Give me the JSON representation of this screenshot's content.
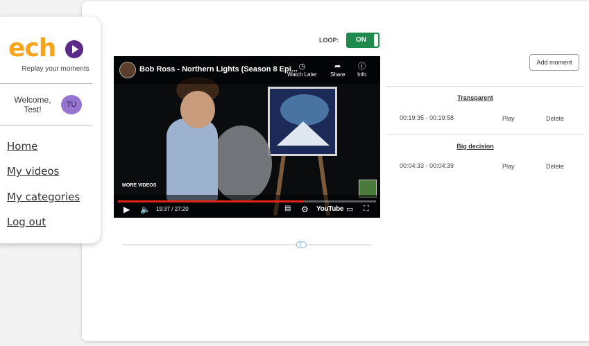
{
  "sidebar": {
    "logo_text": "ech",
    "tagline": "Replay your moments",
    "welcome": "Welcome, Test!",
    "avatar_initials": "TU",
    "nav": [
      {
        "label": "Home"
      },
      {
        "label": "My videos"
      },
      {
        "label": "My categories"
      },
      {
        "label": "Log out"
      }
    ]
  },
  "controls": {
    "loop_label": "LOOP:",
    "loop_state": "ON",
    "add_moment_label": "Add moment"
  },
  "player": {
    "title": "Bob Ross - Northern Lights (Season 8 Epi...",
    "top_buttons": [
      {
        "label": "Watch Later",
        "icon": "clock-icon"
      },
      {
        "label": "Share",
        "icon": "share-icon"
      },
      {
        "label": "Info",
        "icon": "info-icon"
      }
    ],
    "more_videos": "MORE VIDEOS",
    "time": "19:37 / 27:20",
    "progress": 0.718,
    "youtube_label": "YouTube"
  },
  "moments": [
    {
      "title": "Transparent",
      "range": "00:19:35 - 00:19:58",
      "play": "Play",
      "delete": "Delete"
    },
    {
      "title": "Big decision",
      "range": "00:04:33 - 00:04:39",
      "play": "Play",
      "delete": "Delete"
    }
  ],
  "range_slider": {
    "start": 0.71,
    "end": 0.72
  }
}
